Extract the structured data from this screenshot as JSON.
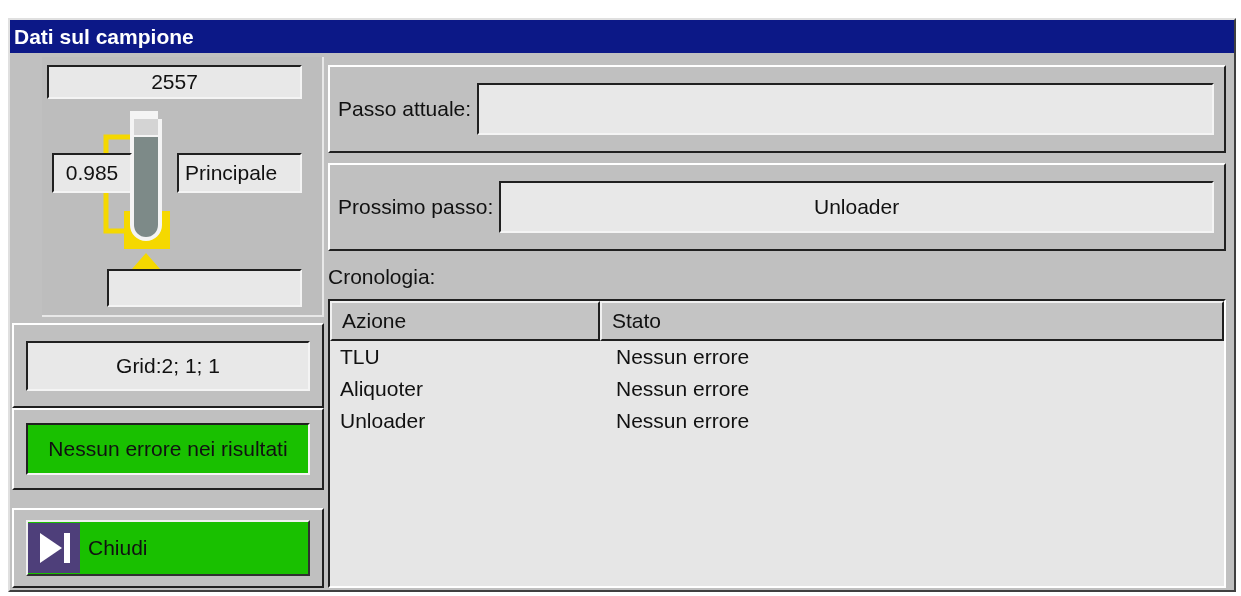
{
  "window": {
    "title": "Dati sul campione"
  },
  "sample": {
    "id": "2557",
    "volume": "0.985",
    "tube_type": "Principale"
  },
  "grid": "Grid:2; 1; 1",
  "result_status": "Nessun errore nei risultati",
  "close_button": {
    "label": "Chiudi"
  },
  "current_step": {
    "label": "Passo attuale:"
  },
  "next_step": {
    "label": "Prossimo passo:",
    "value": "Unloader"
  },
  "history": {
    "label": "Cronologia:",
    "columns": [
      "Azione",
      "Stato"
    ],
    "rows": [
      {
        "action": "TLU",
        "status": "Nessun errore"
      },
      {
        "action": "Aliquoter",
        "status": "Nessun errore"
      },
      {
        "action": "Unloader",
        "status": "Nessun errore"
      }
    ]
  }
}
